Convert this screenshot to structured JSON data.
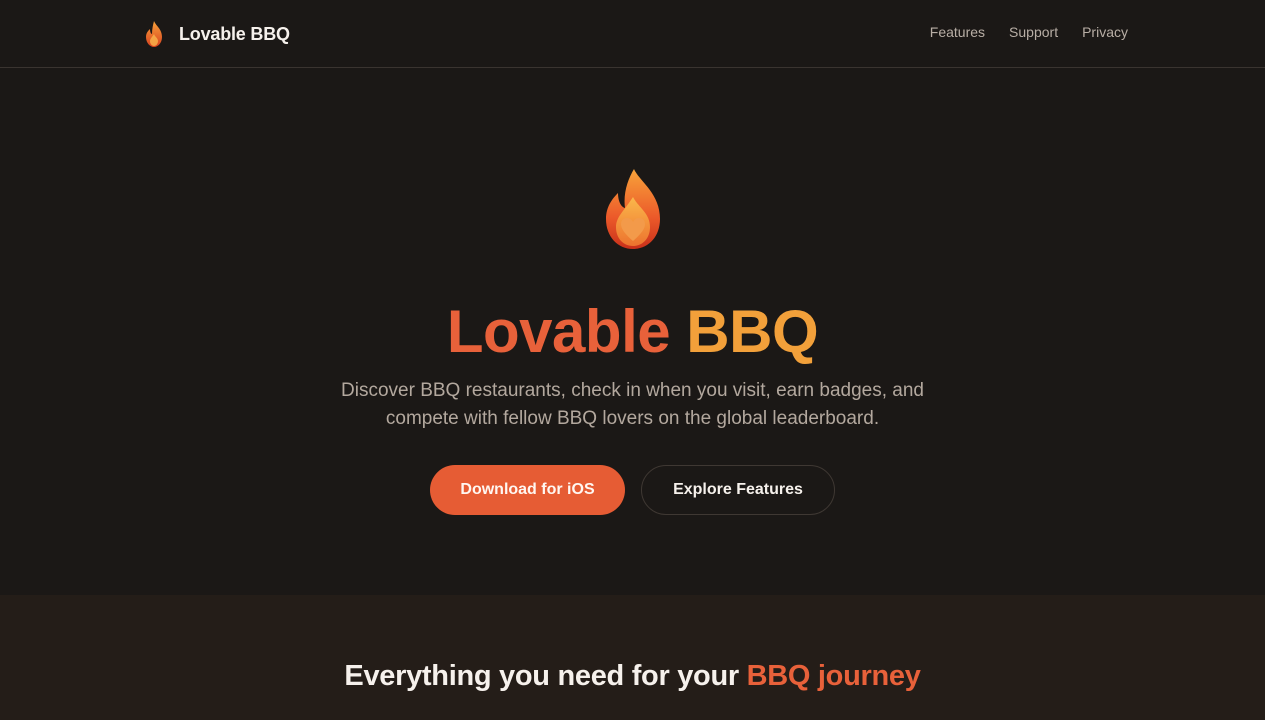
{
  "header": {
    "brand_name": "Lovable BBQ",
    "brand_icon": "flame-icon",
    "nav": [
      "Features",
      "Support",
      "Privacy"
    ]
  },
  "hero": {
    "icon": "flame-heart-icon",
    "title_part1": "Lovable",
    "title_part2": "BBQ",
    "subtitle": "Discover BBQ restaurants, check in when you visit, earn badges, and compete with fellow BBQ lovers on the global leaderboard.",
    "primary_cta": "Download for iOS",
    "secondary_cta": "Explore Features"
  },
  "features": {
    "title_prefix": "Everything you need for your",
    "title_accent": "BBQ journey"
  },
  "colors": {
    "background": "#1b1816",
    "accent_orange": "#e8613a",
    "accent_amber": "#f2a03a",
    "muted_text": "#b3a89e",
    "band_background": "#241d18"
  }
}
